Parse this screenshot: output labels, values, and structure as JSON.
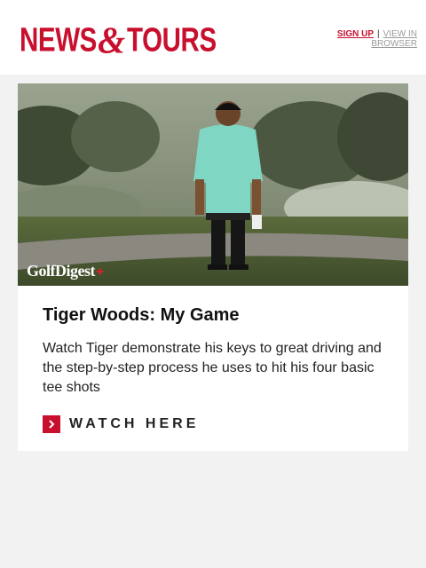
{
  "header": {
    "logo_left": "NEWS",
    "logo_amp": "&",
    "logo_right": "TOURS",
    "signup_label": "SIGN UP",
    "separator": "|",
    "view_in_browser_label": "VIEW IN BROWSER"
  },
  "card": {
    "hero_brand": "GolfDigest",
    "hero_brand_plus": "+",
    "title": "Tiger Woods: My Game",
    "description": "Watch Tiger demonstrate his keys to great driving and the step-by-step process he uses to hit his four basic tee shots",
    "cta_label": "WATCH HERE"
  },
  "colors": {
    "brand_red": "#c8102e",
    "page_bg": "#f2f2f2",
    "card_bg": "#ffffff"
  },
  "icons": {
    "cta_icon": "chevron-right-icon"
  }
}
